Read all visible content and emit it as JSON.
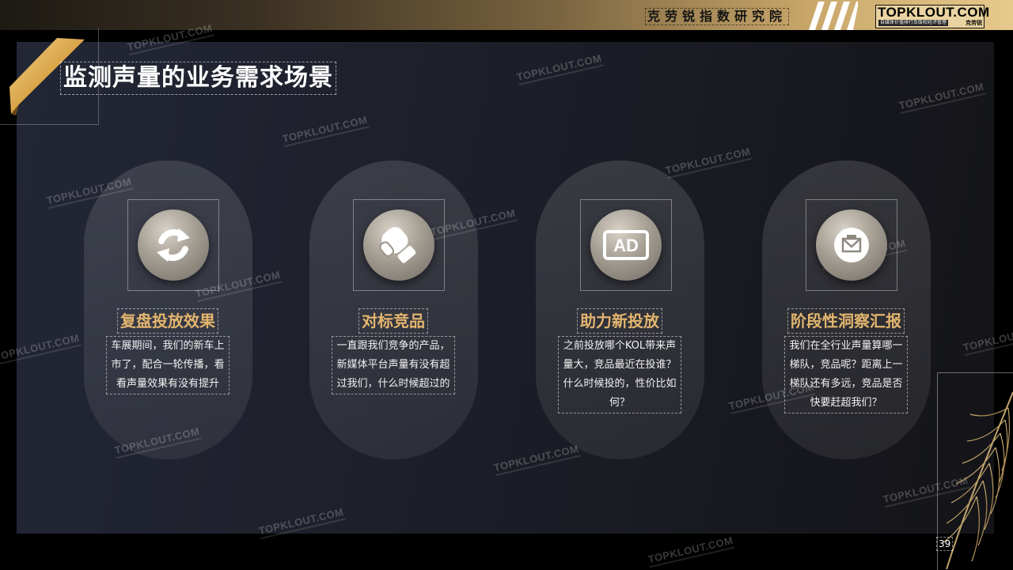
{
  "header": {
    "org_title": "克劳锐指数研究院",
    "logo_text": "TOPKLOUT.COM",
    "logo_subtitle": "自媒体价值排行及版权经济管理",
    "logo_cn": "克劳锐"
  },
  "slide": {
    "title": "监测声量的业务需求场景",
    "page_number": "39",
    "cards": [
      {
        "icon": "refresh-icon",
        "title": "复盘投放效果",
        "description": "车展期间，我们的新车上市了，配合一轮传播，看看声量效果有没有提升"
      },
      {
        "icon": "boxing-glove-icon",
        "title": "对标竞品",
        "description": "一直跟我们竞争的产品，新媒体平台声量有没有超过我们，什么时候超过的"
      },
      {
        "icon": "ad-icon",
        "title": "助力新投放",
        "description": "之前投放哪个KOL带来声量大，竞品最近在投谁？什么时候投的，性价比如何？"
      },
      {
        "icon": "mail-icon",
        "title": "阶段性洞察汇报",
        "description": "我们在全行业声量算哪一梯队，竞品呢？距离上一梯队还有多远，竞品是否快要赶超我们？"
      }
    ]
  },
  "watermark": "TOPKLOUT.COM",
  "colors": {
    "accent_gold": "#e3b56f",
    "panel": "#1f222d",
    "background": "#000000"
  }
}
